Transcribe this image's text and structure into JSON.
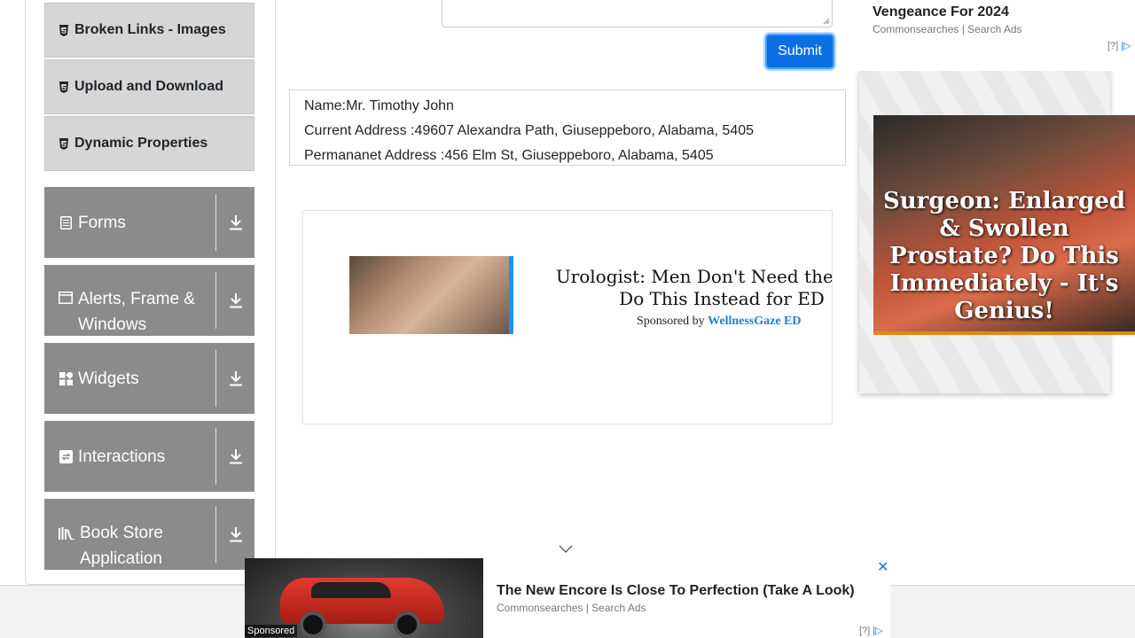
{
  "sidebar": {
    "sub_items": [
      "Broken Links - Images",
      "Upload and Download",
      "Dynamic Properties"
    ],
    "groups": [
      "Forms",
      "Alerts, Frame & Windows",
      "Widgets",
      "Interactions",
      "Book Store Application"
    ]
  },
  "form": {
    "submit_label": "Submit"
  },
  "output": {
    "name": "Name:Mr. Timothy John",
    "current_address": "Current Address :49607 Alexandra Path, Giuseppeboro, Alabama, 5405",
    "permanent_address": "Permananet Address :456 Elm St, Giuseppeboro, Alabama, 5405"
  },
  "mid_ad": {
    "headline_line1": "Urologist: Men Don't Need the \"Blue",
    "headline_line2": "Do This Instead for ED",
    "sponsored_prefix": "Sponsored by",
    "sponsor": "WellnessGaze ED"
  },
  "right_ad": {
    "headline": "Vengeance For 2024",
    "source": "Commonsearches | Search Ads",
    "info": "[?]",
    "image_text": "Surgeon: Enlarged & Swollen Prostate? Do This Immediately - It's Genius!"
  },
  "bottom_ad": {
    "sponsored_tag": "Sponsored",
    "headline": "The New Encore Is Close To Perfection (Take A Look)",
    "source": "Commonsearches | Search Ads",
    "info": "[?]"
  },
  "colors": {
    "submit_button": "#0b6fe3",
    "sidebar_group_bg": "#8b8b8b",
    "sidebar_subitem_bg": "#d6d6d6",
    "sponsor_link": "#1e7fd6"
  }
}
